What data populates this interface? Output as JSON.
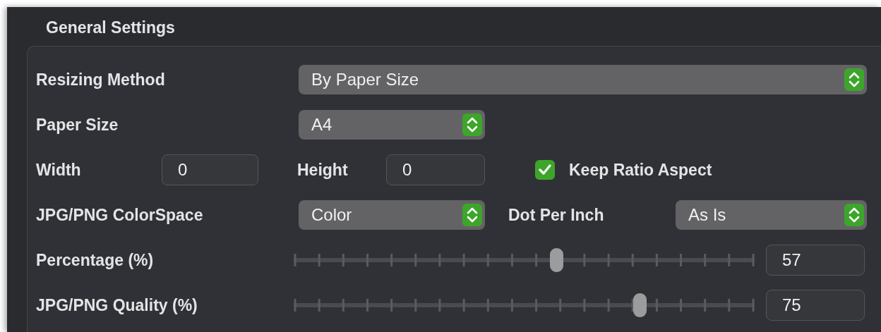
{
  "section_title": "General Settings",
  "resizing_method": {
    "label": "Resizing Method",
    "value": "By Paper Size"
  },
  "paper_size": {
    "label": "Paper Size",
    "value": "A4"
  },
  "width": {
    "label": "Width",
    "value": "0"
  },
  "height": {
    "label": "Height",
    "value": "0"
  },
  "keep_ratio": {
    "label": "Keep Ratio Aspect",
    "checked": true
  },
  "color_space": {
    "label": "JPG/PNG ColorSpace",
    "value": "Color"
  },
  "dpi": {
    "label": "Dot Per Inch",
    "value": "As Is"
  },
  "sliders": [
    {
      "label": "Percentage (%)",
      "level": 0.57,
      "value": "57"
    },
    {
      "label": "JPG/PNG Quality (%)",
      "level": 0.75,
      "value": "75"
    }
  ]
}
